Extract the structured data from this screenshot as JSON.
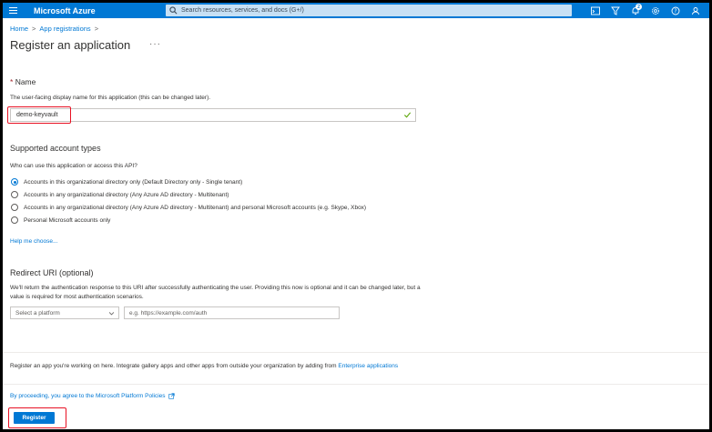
{
  "topbar": {
    "brand": "Microsoft Azure",
    "search_placeholder": "Search resources, services, and docs (G+/)",
    "notification_count": "2",
    "icons": [
      "terminal-icon",
      "directory-filter-icon",
      "notifications-icon",
      "settings-icon",
      "help-icon",
      "feedback-icon"
    ]
  },
  "breadcrumb": {
    "home": "Home",
    "sep": ">",
    "app_reg": "App registrations"
  },
  "page": {
    "title": "Register an application",
    "more": "···"
  },
  "name_section": {
    "required_mark": "*",
    "label": "Name",
    "help": "The user-facing display name for this application (this can be changed later).",
    "value": "demo-keyvault"
  },
  "account_types": {
    "title": "Supported account types",
    "question": "Who can use this application or access this API?",
    "options": [
      {
        "label": "Accounts in this organizational directory only (Default Directory only - Single tenant)",
        "selected": true
      },
      {
        "label": "Accounts in any organizational directory (Any Azure AD directory - Multitenant)",
        "selected": false
      },
      {
        "label": "Accounts in any organizational directory (Any Azure AD directory - Multitenant) and personal Microsoft accounts (e.g. Skype, Xbox)",
        "selected": false
      },
      {
        "label": "Personal Microsoft accounts only",
        "selected": false
      }
    ],
    "help_link": "Help me choose..."
  },
  "redirect": {
    "title": "Redirect URI (optional)",
    "description": "We'll return the authentication response to this URI after successfully authenticating the user. Providing this now is optional and it can be changed later, but a value is required for most authentication scenarios.",
    "platform_placeholder": "Select a platform",
    "uri_placeholder": "e.g. https://example.com/auth"
  },
  "footer": {
    "gallery_text": "Register an app you're working on here. Integrate gallery apps and other apps from outside your organization by adding from",
    "gallery_link": "Enterprise applications",
    "policy_text": "By proceeding, you agree to the Microsoft Platform Policies",
    "register_label": "Register"
  },
  "colors": {
    "accent": "#0078d4",
    "highlight": "#e81123"
  }
}
